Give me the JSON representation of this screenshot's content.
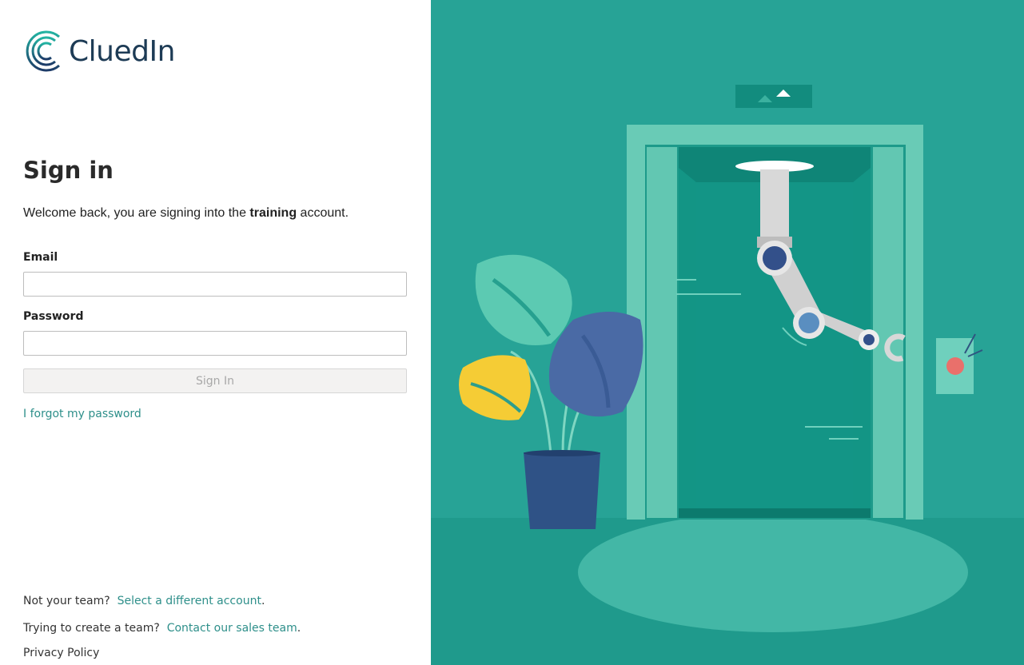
{
  "brand": {
    "name": "CluedIn"
  },
  "signin": {
    "title": "Sign in",
    "welcome_prefix": "Welcome back, you are signing into the ",
    "account_name": "training",
    "welcome_suffix": " account.",
    "email_label": "Email",
    "email_value": "",
    "password_label": "Password",
    "password_value": "",
    "submit_label": "Sign In",
    "forgot_link": "I forgot my password"
  },
  "footer": {
    "team_prefix": "Not your team?",
    "team_link": "Select a different account",
    "team_suffix": ".",
    "create_prefix": "Trying to create a team?",
    "create_link": "Contact our sales team",
    "create_suffix": ".",
    "privacy_link": "Privacy Policy"
  },
  "colors": {
    "accent": "#2e8f8a",
    "illustration_bg": "#27a396",
    "logo_dark": "#1d3b55"
  },
  "icons": [
    "cluedin-logo-icon",
    "robot-elevator-illustration"
  ]
}
